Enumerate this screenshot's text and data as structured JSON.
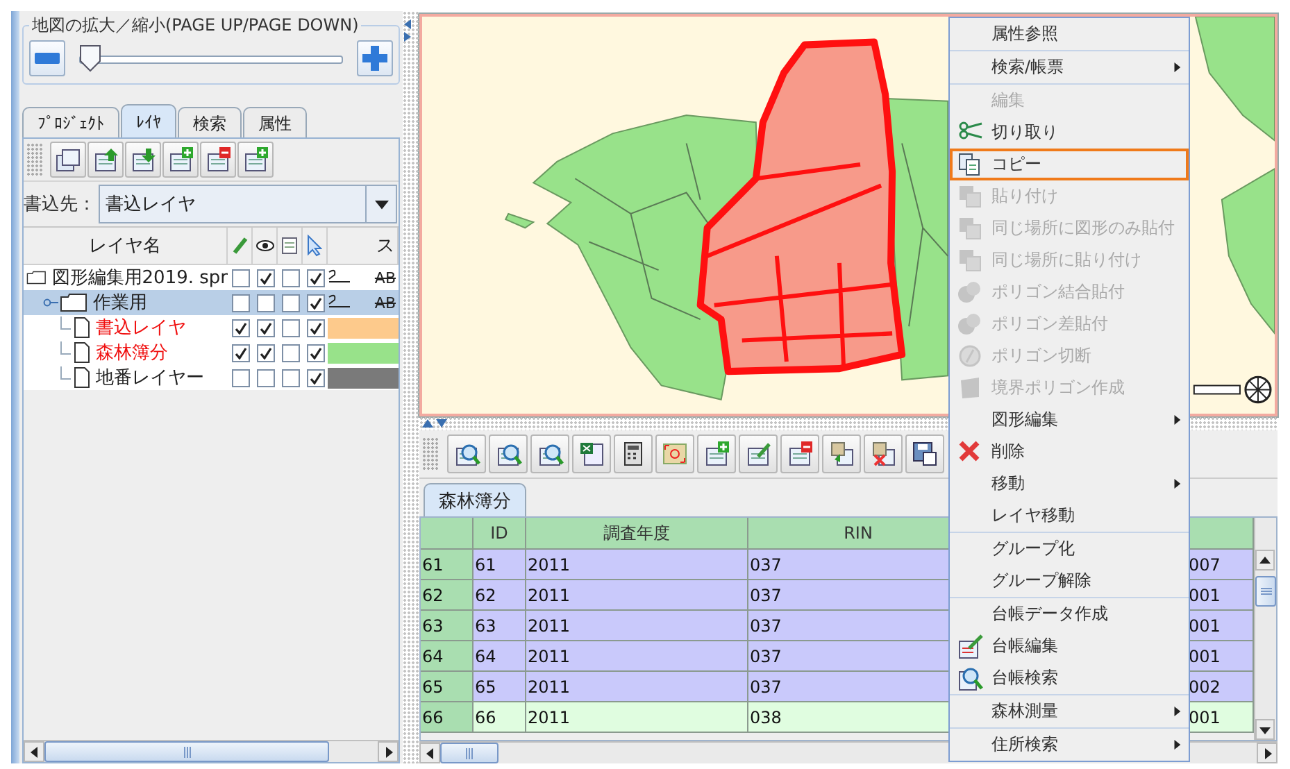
{
  "zoom_panel": {
    "title": "地図の拡大／縮小(PAGE UP/PAGE DOWN)",
    "level": 0.02
  },
  "side_tabs": [
    {
      "label": "ﾌﾟﾛｼﾞｪｸﾄ",
      "selected": false
    },
    {
      "label": "ﾚｲﾔ",
      "selected": true
    },
    {
      "label": "検索",
      "selected": false
    },
    {
      "label": "属性",
      "selected": false
    }
  ],
  "write_target": {
    "label": "書込先：",
    "value": "書込レイヤ"
  },
  "layer_tree": {
    "name_header": "レイヤ名",
    "column_6": "ス",
    "rows": [
      {
        "name": "図形編集用2019. spr",
        "kind": "project",
        "selected": false,
        "emphasized": false,
        "checks": [
          false,
          true,
          false,
          true
        ],
        "style": {
          "kind": "sample",
          "label": "AB"
        },
        "children": [
          {
            "name": "作業用",
            "kind": "folder",
            "expanded": true,
            "selected": true,
            "emphasized": false,
            "checks": [
              false,
              false,
              false,
              true
            ],
            "style": {
              "kind": "sample",
              "label": "AB"
            },
            "children": [
              {
                "name": "書込レイヤ",
                "kind": "layer",
                "selected": false,
                "emphasized": true,
                "checks": [
                  true,
                  true,
                  false,
                  true
                ],
                "style": {
                  "kind": "fill",
                  "color": "#fdca8c"
                }
              },
              {
                "name": "森林簿分",
                "kind": "layer",
                "selected": false,
                "emphasized": true,
                "checks": [
                  true,
                  true,
                  false,
                  true
                ],
                "style": {
                  "kind": "fill",
                  "color": "#98e28a"
                }
              },
              {
                "name": "地番レイヤー",
                "kind": "layer",
                "selected": false,
                "emphasized": false,
                "checks": [
                  false,
                  false,
                  false,
                  true
                ],
                "style": {
                  "kind": "fill",
                  "color": "#7a7a7a"
                }
              }
            ]
          }
        ]
      }
    ]
  },
  "table_tabs": [
    {
      "label": "森林簿分",
      "selected": true
    }
  ],
  "table": {
    "columns": [
      "ID",
      "調査年度",
      "RIN"
    ],
    "rows": [
      {
        "header": "61",
        "cells": [
          "61",
          "2011",
          "037",
          "007"
        ],
        "selected": true
      },
      {
        "header": "62",
        "cells": [
          "62",
          "2011",
          "037",
          "001"
        ],
        "selected": true
      },
      {
        "header": "63",
        "cells": [
          "63",
          "2011",
          "037",
          "001"
        ],
        "selected": true
      },
      {
        "header": "64",
        "cells": [
          "64",
          "2011",
          "037",
          "001"
        ],
        "selected": true
      },
      {
        "header": "65",
        "cells": [
          "65",
          "2011",
          "037",
          "002"
        ],
        "selected": true
      },
      {
        "header": "66",
        "cells": [
          "66",
          "2011",
          "038",
          "001"
        ],
        "selected": false
      }
    ]
  },
  "context_menu": {
    "items": [
      {
        "kind": "item",
        "label": "属性参照",
        "disabled": false,
        "selected": false,
        "submenu": false
      },
      {
        "kind": "separator"
      },
      {
        "kind": "item",
        "label": "検索/帳票",
        "disabled": false,
        "selected": false,
        "submenu": true
      },
      {
        "kind": "separator"
      },
      {
        "kind": "item",
        "label": "編集",
        "disabled": true,
        "selected": false,
        "submenu": false
      },
      {
        "kind": "item",
        "label": "切り取り",
        "disabled": false,
        "selected": false,
        "submenu": false
      },
      {
        "kind": "item",
        "label": "コピー",
        "disabled": false,
        "selected": true,
        "submenu": false
      },
      {
        "kind": "item",
        "label": "貼り付け",
        "disabled": true,
        "selected": false,
        "submenu": false
      },
      {
        "kind": "item",
        "label": "同じ場所に図形のみ貼付",
        "disabled": true,
        "selected": false,
        "submenu": false
      },
      {
        "kind": "item",
        "label": "同じ場所に貼り付け",
        "disabled": true,
        "selected": false,
        "submenu": false
      },
      {
        "kind": "item",
        "label": "ポリゴン結合貼付",
        "disabled": true,
        "selected": false,
        "submenu": false
      },
      {
        "kind": "item",
        "label": "ポリゴン差貼付",
        "disabled": true,
        "selected": false,
        "submenu": false
      },
      {
        "kind": "item",
        "label": "ポリゴン切断",
        "disabled": true,
        "selected": false,
        "submenu": false
      },
      {
        "kind": "item",
        "label": "境界ポリゴン作成",
        "disabled": true,
        "selected": false,
        "submenu": false
      },
      {
        "kind": "item",
        "label": "図形編集",
        "disabled": false,
        "selected": false,
        "submenu": true
      },
      {
        "kind": "item",
        "label": "削除",
        "disabled": false,
        "selected": false,
        "submenu": false
      },
      {
        "kind": "item",
        "label": "移動",
        "disabled": false,
        "selected": false,
        "submenu": true
      },
      {
        "kind": "item",
        "label": "レイヤ移動",
        "disabled": false,
        "selected": false,
        "submenu": false
      },
      {
        "kind": "separator"
      },
      {
        "kind": "item",
        "label": "グループ化",
        "disabled": false,
        "selected": false,
        "submenu": false
      },
      {
        "kind": "item",
        "label": "グループ解除",
        "disabled": false,
        "selected": false,
        "submenu": false
      },
      {
        "kind": "separator"
      },
      {
        "kind": "item",
        "label": "台帳データ作成",
        "disabled": false,
        "selected": false,
        "submenu": false
      },
      {
        "kind": "item",
        "label": "台帳編集",
        "disabled": false,
        "selected": false,
        "submenu": false
      },
      {
        "kind": "item",
        "label": "台帳検索",
        "disabled": false,
        "selected": false,
        "submenu": false
      },
      {
        "kind": "separator"
      },
      {
        "kind": "item",
        "label": "森林測量",
        "disabled": false,
        "selected": false,
        "submenu": true
      },
      {
        "kind": "separator"
      },
      {
        "kind": "item",
        "label": "住所検索",
        "disabled": false,
        "selected": false,
        "submenu": true
      }
    ]
  }
}
